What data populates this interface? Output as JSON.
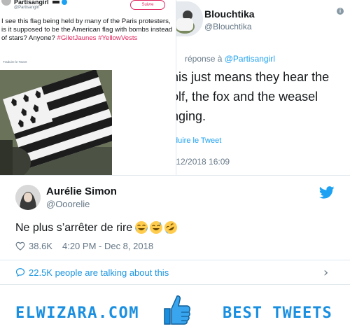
{
  "collage": {
    "left_tweet": {
      "name": "Partisangirl",
      "handle": "@Partisangirl",
      "follow_label": "Suivre",
      "text": "I see this flag being held by many of the Paris protesters, is it supposed to be the American flag with bombs instead of stars? Anyone?",
      "hashtags": "#GiletJaunes #YellowVests",
      "translate_label": "Traduire le Tweet"
    },
    "right_tweet": {
      "name": "Blouchtika",
      "handle": "@Blouchtika",
      "reply_prefix": "réponse à",
      "reply_to": "@Partisangirl",
      "text_line1": "his just means they hear the",
      "text_line2": "olf, the fox and the weasel",
      "text_line3": "nging.",
      "translate_label": "duire le Tweet",
      "date": "/12/2018 16:09",
      "info_glyph": "i"
    }
  },
  "tweet": {
    "author_name": "Aurélie Simon",
    "author_handle": "@Ooorelie",
    "text": "Ne plus s’arrêter de rire",
    "emojis": [
      "face-with-tears-of-joy",
      "grinning-face-with-sweat",
      "rolling-on-floor-laughing"
    ],
    "likes": "38.6K",
    "time": "4:20 PM - Dec 8, 2018",
    "talking_label": "22.5K people are talking about this",
    "chevron": "›"
  },
  "banner": {
    "brand": "ELWIZARA.COM",
    "tagline": "BEST TWEETS"
  },
  "colors": {
    "twitter_blue": "#1da1f2",
    "link_blue": "#1b95e0",
    "brand_blue": "#1a8fe0",
    "muted_text": "#657786",
    "hashtag_pink": "#e0245e"
  }
}
